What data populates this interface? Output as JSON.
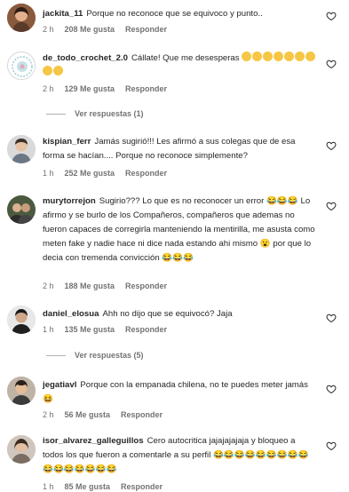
{
  "comments": [
    {
      "username": "jackita_11",
      "text": "Porque no reconoce que se equivoco y punto..",
      "time": "2 h",
      "likes": "208 Me gusta",
      "reply": "Responder",
      "emojis": []
    },
    {
      "username": "de_todo_crochet_2.0",
      "text": "Cállate! Que me desesperas",
      "time": "2 h",
      "likes": "129 Me gusta",
      "reply": "Responder",
      "emojis": [
        "frustrated-face",
        "frustrated-face",
        "frustrated-face",
        "frustrated-face",
        "frustrated-face",
        "frustrated-face",
        "frustrated-face",
        "frustrated-face",
        "frustrated-face"
      ]
    },
    {
      "username": "kispian_ferr",
      "text": "Jamás sugirió!!! Les afirmó a sus colegas que de esa forma se hacían.... Porque no reconoce simplemente?",
      "time": "1 h",
      "likes": "252 Me gusta",
      "reply": "Responder",
      "emojis": []
    },
    {
      "username": "murytorrejon",
      "text": "Sugirio??? Lo que es no reconocer un error 😂😂😂 Lo afirmo y se burlo de los Compañeros, compañeros que ademas no fueron capaces de corregirla manteniendo la mentirilla, me asusta como meten fake y nadie hace ni dice nada estando ahi mismo 😮 por que lo decia con tremenda convicción 😂😂😂",
      "time": "2 h",
      "likes": "188 Me gusta",
      "reply": "Responder",
      "emojis": []
    },
    {
      "username": "daniel_elosua",
      "text": "Ahh no dijo que se equivocó? Jaja",
      "time": "1 h",
      "likes": "135 Me gusta",
      "reply": "Responder",
      "emojis": []
    },
    {
      "username": "jegatiavl",
      "text": "Porque con la empanada chilena, no te puedes meter jamás 😆",
      "time": "2 h",
      "likes": "56 Me gusta",
      "reply": "Responder",
      "emojis": []
    },
    {
      "username": "isor_alvarez_galleguillos",
      "text": "Cero autocritica jajajajajaja y bloqueo a todos los que fueron a comentarle a su perfil 😂😂😂😂😂😂😂😂😂😂😂😂😂😂😂😂",
      "time": "1 h",
      "likes": "85 Me gusta",
      "reply": "Responder",
      "emojis": []
    }
  ],
  "view_replies": [
    {
      "label": "Ver respuestas (1)"
    },
    {
      "label": "Ver respuestas (5)"
    }
  ],
  "icons": {
    "like": "heart-outline-icon"
  },
  "colors": {
    "text": "#262626",
    "meta": "#737373",
    "background": "#ffffff"
  }
}
